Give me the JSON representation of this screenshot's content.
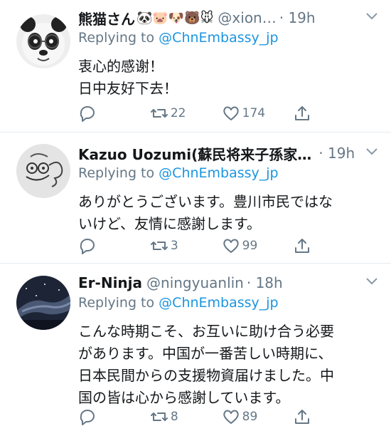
{
  "tweets": [
    {
      "name": "熊猫さん",
      "emoji": "🐼🐷🐶🐻🐭",
      "handle": "@xion…",
      "time": "· 19h",
      "reply_prefix": "Replying to",
      "reply_to": "@ChnEmbassy_jp",
      "text": "衷心的感谢！\n日中友好下去！",
      "retweets": "22",
      "likes": "174"
    },
    {
      "name": "Kazuo Uozumi(蘇民将来子孫家…",
      "handle": "",
      "time": "· 19h",
      "reply_prefix": "Replying to",
      "reply_to": "@ChnEmbassy_jp",
      "text": "ありがとうございます。豊川市民ではな\nいけど、友情に感謝します。",
      "retweets": "3",
      "likes": "99"
    },
    {
      "name": "Er-Ninja",
      "handle": "@ningyuanlin",
      "time": "· 18h",
      "reply_prefix": "Replying to",
      "reply_to": "@ChnEmbassy_jp",
      "text": "こんな時期こそ、お互いに助け合う必要\nがあります。中国が一番苦しい時期に、\n日本民間からの支援物資届けました。中\n国の皆は心から感謝しています。",
      "retweets": "8",
      "likes": "89"
    }
  ]
}
